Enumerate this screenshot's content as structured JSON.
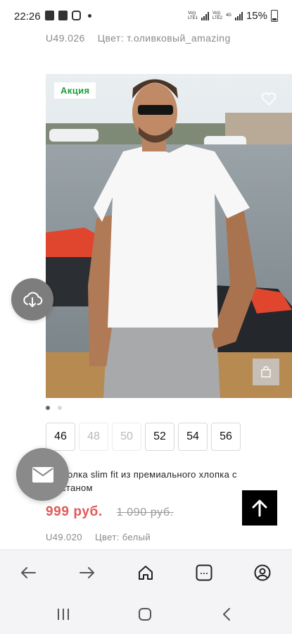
{
  "status_bar": {
    "time": "22:26",
    "net1": "Vo))\nLTE1",
    "net2": "Vo))\nLTE2",
    "net3": "4G",
    "battery": "15%"
  },
  "prev_product": {
    "sku": "U49.026",
    "color": "Цвет: т.оливковый_amazing"
  },
  "product": {
    "badge": "Акция",
    "sizes": [
      {
        "label": "46",
        "available": true
      },
      {
        "label": "48",
        "available": false
      },
      {
        "label": "50",
        "available": false
      },
      {
        "label": "52",
        "available": true
      },
      {
        "label": "54",
        "available": true
      },
      {
        "label": "56",
        "available": true
      }
    ],
    "title": "Футболка slim fit из премиального хлопка с эластаном",
    "price": "999 руб.",
    "old_price": "1 090 руб.",
    "sku": "U49.020",
    "color": "Цвет: белый"
  },
  "icons": {
    "favorite": "heart-icon",
    "cart": "shopping-bag-icon",
    "download": "cloud-download-icon",
    "mail": "envelope-icon",
    "scroll_top": "arrow-up-icon"
  },
  "colors": {
    "badge_green": "#1e9e3a",
    "price_red": "#e05858"
  }
}
